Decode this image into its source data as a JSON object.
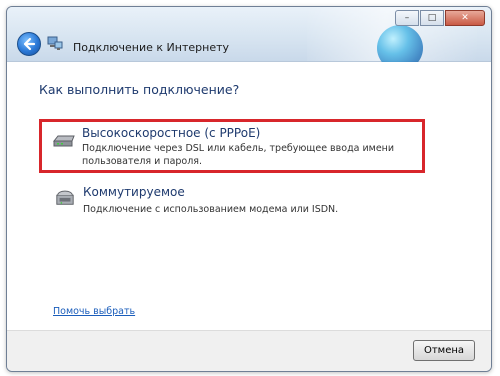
{
  "window": {
    "title": "Подключение к Интернету",
    "controls": {
      "minimize": "–",
      "maximize": "□",
      "close": "✕"
    }
  },
  "content": {
    "question": "Как выполнить подключение?",
    "options": [
      {
        "title": "Высокоскоростное (с PPPoE)",
        "description": "Подключение через DSL или кабель, требующее ввода имени пользователя и пароля.",
        "icon": "modem-icon",
        "highlighted": true,
        "highlight_color": "#d8262b"
      },
      {
        "title": "Коммутируемое",
        "description": "Подключение с использованием модема или ISDN.",
        "icon": "dialup-modem-icon",
        "highlighted": false
      }
    ],
    "help_link": "Помочь выбрать"
  },
  "footer": {
    "cancel_label": "Отмена"
  }
}
